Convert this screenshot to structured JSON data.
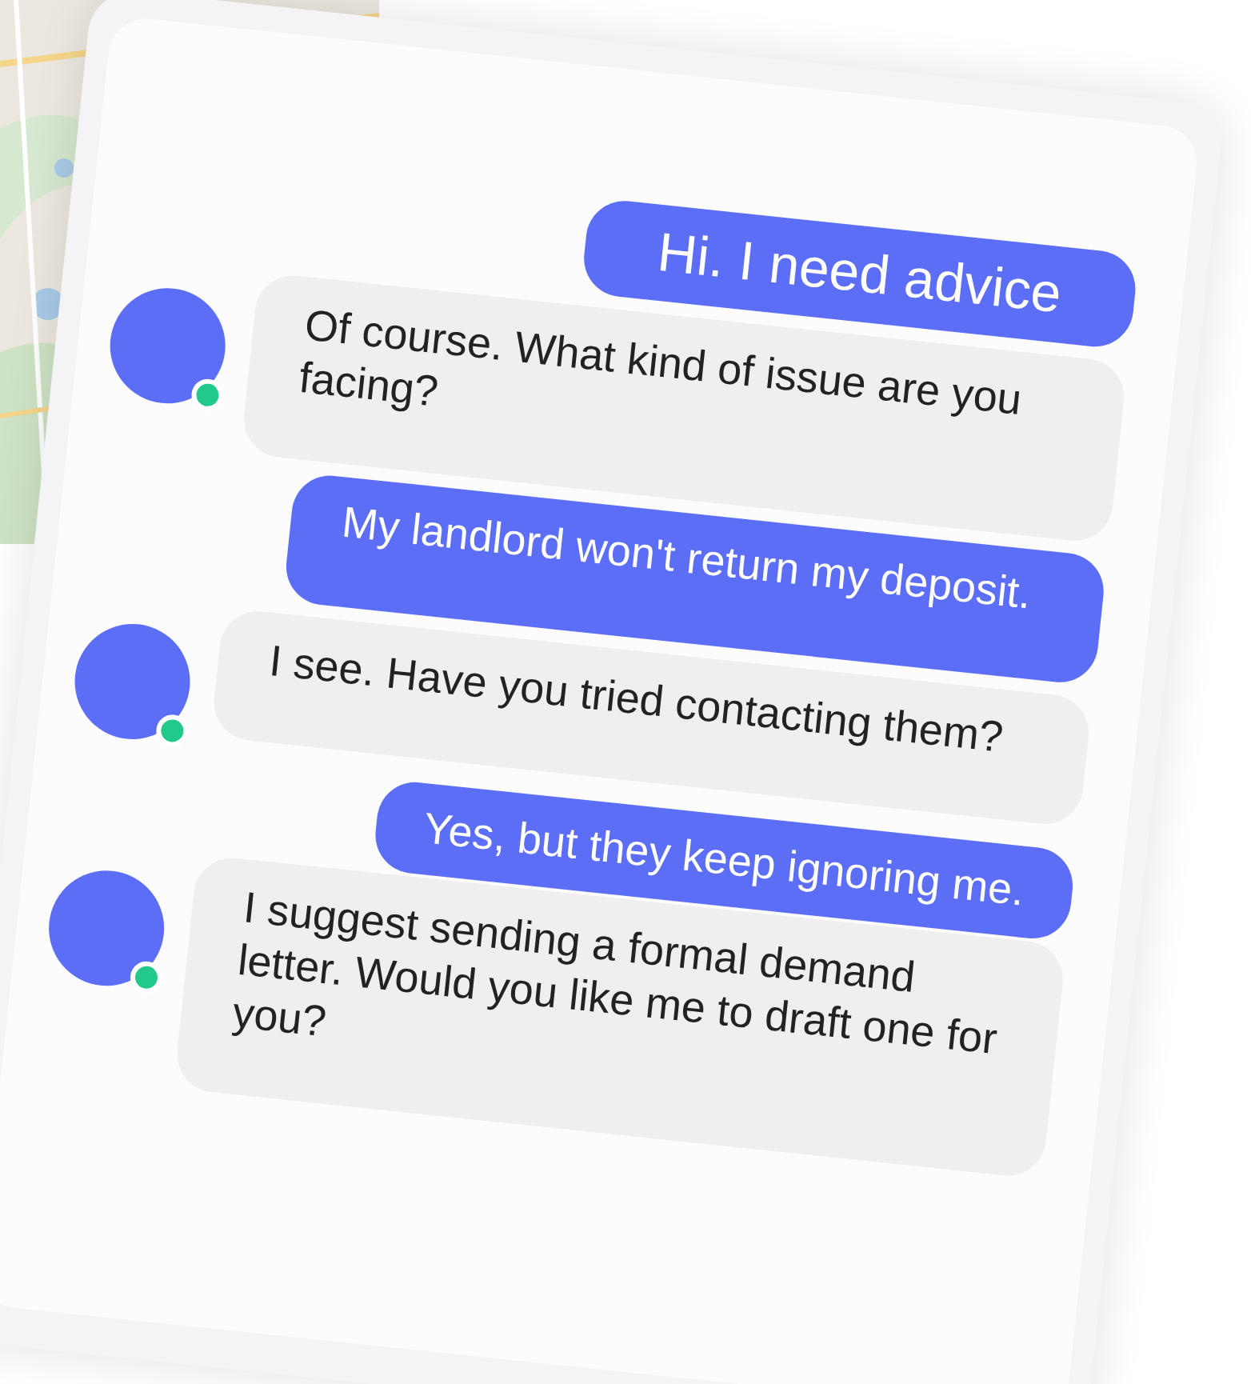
{
  "messages": [
    {
      "kind": "user",
      "text": "Hi. I need advice"
    },
    {
      "kind": "bot",
      "text": "Of course. What kind of issue are you facing?",
      "online": true
    },
    {
      "kind": "user",
      "text": "My landlord won't return my deposit."
    },
    {
      "kind": "bot",
      "text": "I see. Have you tried contacting them?",
      "online": true
    },
    {
      "kind": "user",
      "text": "Yes, but they keep ignoring me."
    },
    {
      "kind": "bot",
      "text": "I suggest sending a formal demand letter. Would you like me to draft one for you?",
      "online": true
    }
  ]
}
